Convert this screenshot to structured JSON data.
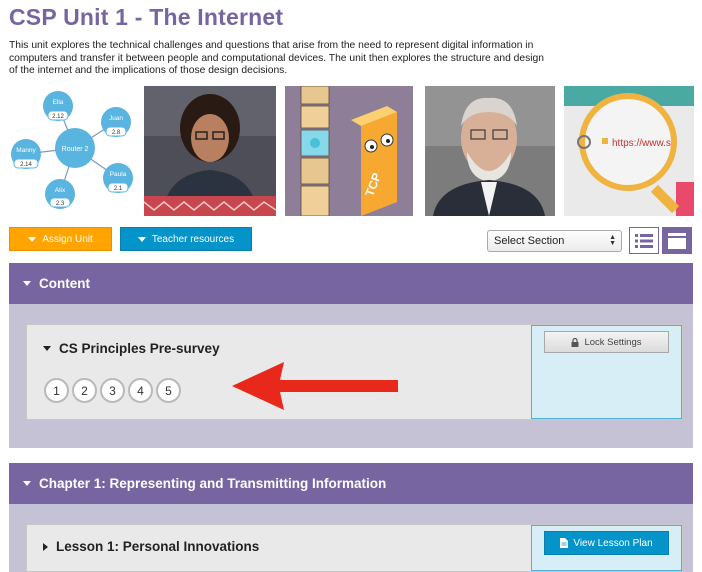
{
  "page": {
    "title": "CSP Unit 1 - The Internet",
    "description": "This unit explores the technical challenges and questions that arise from the need to represent digital information in computers and transfer it between people and computational devices. The unit then explores the structure and design of the internet and the implications of those design decisions."
  },
  "diagram": {
    "router_label": "Router 2",
    "nodes": [
      {
        "name": "Ella",
        "value": "2.12"
      },
      {
        "name": "Juan",
        "value": "2.8"
      },
      {
        "name": "Manny",
        "value": "2.14"
      },
      {
        "name": "Paula",
        "value": "2.1"
      },
      {
        "name": "Alix",
        "value": "2.3"
      }
    ]
  },
  "thumbnails": {
    "tcp_text": "TCP",
    "url_text": "https://www.s"
  },
  "toolbar": {
    "assign_label": "Assign Unit",
    "teacher_label": "Teacher resources",
    "section_select_value": "Select Section"
  },
  "sections": [
    {
      "title": "Content",
      "lesson": {
        "title": "CS Principles Pre-survey",
        "bubbles": [
          "1",
          "2",
          "3",
          "4",
          "5"
        ],
        "side_button": "Lock Settings"
      }
    },
    {
      "title": "Chapter 1: Representing and Transmitting Information",
      "lesson": {
        "title": "Lesson 1: Personal Innovations",
        "side_button": "View Lesson Plan"
      }
    }
  ],
  "colors": {
    "brand_purple": "#7665a0",
    "assign_orange": "#ffa400",
    "teacher_blue": "#0594ca",
    "annotation_red": "#e8281b"
  }
}
